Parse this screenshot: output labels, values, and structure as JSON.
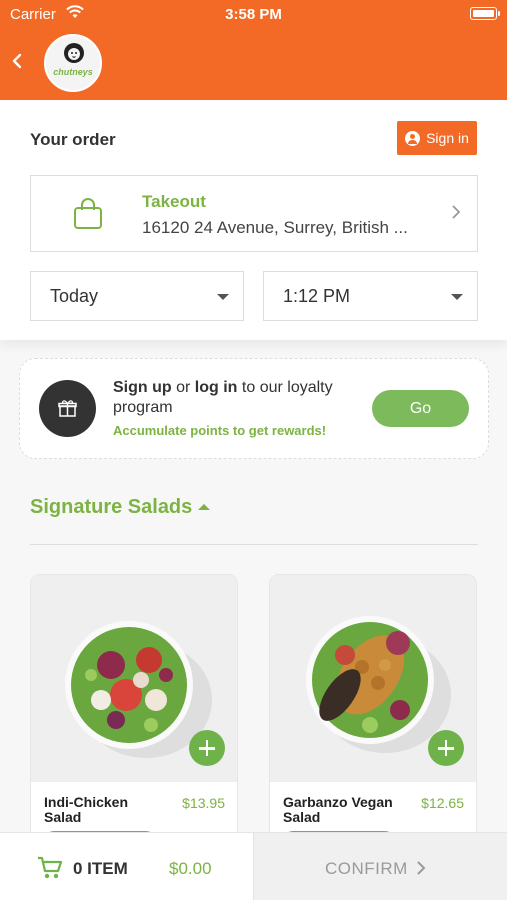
{
  "status_bar": {
    "carrier": "Carrier",
    "time": "3:58 PM"
  },
  "header": {
    "logo_text": "chutneys"
  },
  "order": {
    "title": "Your order",
    "signin_label": "Sign in",
    "mode": "Takeout",
    "address": "16120 24 Avenue, Surrey, British ...",
    "day": "Today",
    "time": "1:12 PM"
  },
  "loyalty": {
    "signup": "Sign up",
    "or": "or",
    "login": "log in",
    "rest": "to our loyalty program",
    "subtitle": "Accumulate points to get rewards!",
    "go_label": "Go"
  },
  "section": {
    "title": "Signature Salads"
  },
  "products": [
    {
      "name": "Indi-Chicken Salad",
      "price": "$13.95"
    },
    {
      "name": "Garbanzo Vegan Salad",
      "price": "$12.65"
    }
  ],
  "cart": {
    "items": "0 ITEM",
    "total": "$0.00",
    "confirm_label": "CONFIRM"
  },
  "colors": {
    "brand_orange": "#f26a25",
    "accent_green": "#7cb342",
    "dark": "#333333"
  }
}
